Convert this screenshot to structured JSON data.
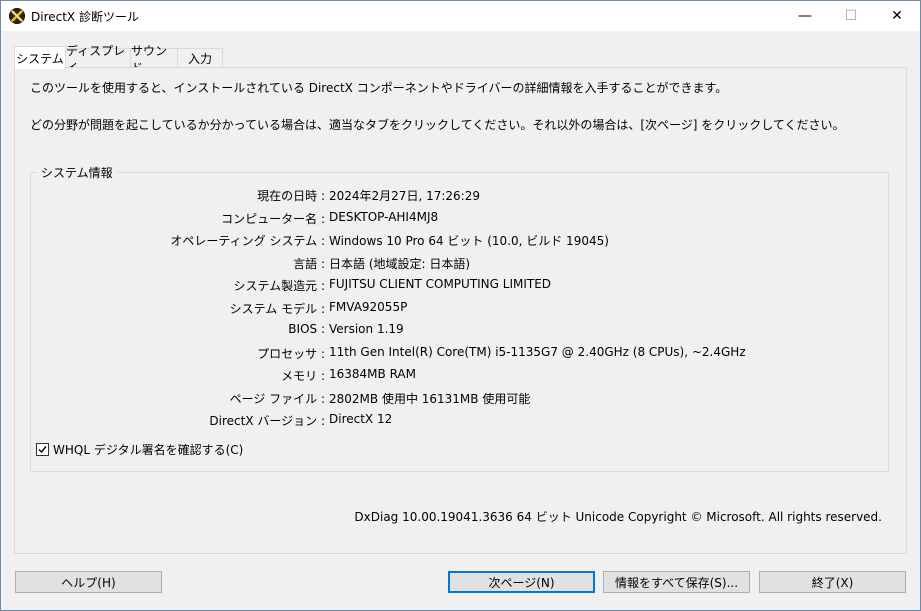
{
  "window": {
    "title": "DirectX 診断ツール",
    "minimize_glyph": "—",
    "maximize_glyph": "☐",
    "close_glyph": "✕"
  },
  "tabs": [
    {
      "label": "システム",
      "active": true
    },
    {
      "label": "ディスプレイ",
      "active": false
    },
    {
      "label": "サウンド",
      "active": false
    },
    {
      "label": "入力",
      "active": false
    }
  ],
  "intro": {
    "line1": "このツールを使用すると、インストールされている DirectX コンポーネントやドライバーの詳細情報を入手することができます。",
    "line2": "どの分野が問題を起こしているか分かっている場合は、適当なタブをクリックしてください。それ以外の場合は、[次ページ] をクリックしてください。"
  },
  "system_info": {
    "group_title": "システム情報",
    "rows": [
      {
        "label": "現在の日時 :",
        "value": "2024年2月27日, 17:26:29"
      },
      {
        "label": "コンピューター名 :",
        "value": "DESKTOP-AHI4MJ8"
      },
      {
        "label": "オペレーティング システム :",
        "value": "Windows 10 Pro 64 ビット (10.0, ビルド 19045)"
      },
      {
        "label": "言語 :",
        "value": "日本語 (地域設定: 日本語)"
      },
      {
        "label": "システム製造元 :",
        "value": "FUJITSU CLIENT COMPUTING LIMITED"
      },
      {
        "label": "システム モデル :",
        "value": "FMVA92055P"
      },
      {
        "label": "BIOS :",
        "value": "Version 1.19"
      },
      {
        "label": "プロセッサ :",
        "value": "11th Gen Intel(R) Core(TM) i5-1135G7 @ 2.40GHz (8 CPUs), ~2.4GHz"
      },
      {
        "label": "メモリ :",
        "value": "16384MB RAM"
      },
      {
        "label": "ページ ファイル :",
        "value": "2802MB 使用中 16131MB 使用可能"
      },
      {
        "label": "DirectX バージョン :",
        "value": "DirectX 12"
      }
    ]
  },
  "whql": {
    "label": "WHQL デジタル署名を確認する(C)",
    "checked": true
  },
  "footer_note": "DxDiag 10.00.19041.3636 64 ビット Unicode  Copyright © Microsoft. All rights reserved.",
  "buttons": {
    "help": "ヘルプ(H)",
    "next": "次ページ(N)",
    "save_all": "情報をすべて保存(S)...",
    "exit": "終了(X)"
  },
  "colors": {
    "accent": "#0078d7",
    "window_bg": "#f0f0f0"
  }
}
